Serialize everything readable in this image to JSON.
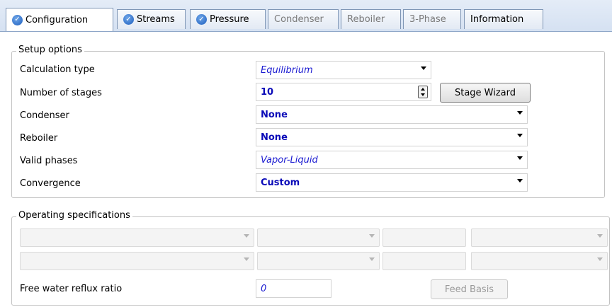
{
  "tabs": [
    {
      "label": "Configuration",
      "status": "complete",
      "active": true
    },
    {
      "label": "Streams",
      "status": "complete",
      "active": false
    },
    {
      "label": "Pressure",
      "status": "complete",
      "active": false
    },
    {
      "label": "Condenser",
      "status": "disabled",
      "active": false
    },
    {
      "label": "Reboiler",
      "status": "disabled",
      "active": false
    },
    {
      "label": "3-Phase",
      "status": "disabled",
      "active": false
    },
    {
      "label": "Information",
      "status": "normal",
      "active": false
    }
  ],
  "setup": {
    "legend": "Setup options",
    "calculation_type": {
      "label": "Calculation type",
      "value": "Equilibrium"
    },
    "number_of_stages": {
      "label": "Number of stages",
      "value": "10"
    },
    "stage_wizard_label": "Stage Wizard",
    "condenser": {
      "label": "Condenser",
      "value": "None"
    },
    "reboiler": {
      "label": "Reboiler",
      "value": "None"
    },
    "valid_phases": {
      "label": "Valid phases",
      "value": "Vapor-Liquid"
    },
    "convergence": {
      "label": "Convergence",
      "value": "Custom"
    }
  },
  "operating": {
    "legend": "Operating specifications",
    "free_water_label": "Free water reflux ratio",
    "free_water_value": "0",
    "feed_basis_label": "Feed Basis"
  },
  "colors": {
    "accent": "#1e5fbf",
    "value_text": "#1b1bd1"
  }
}
